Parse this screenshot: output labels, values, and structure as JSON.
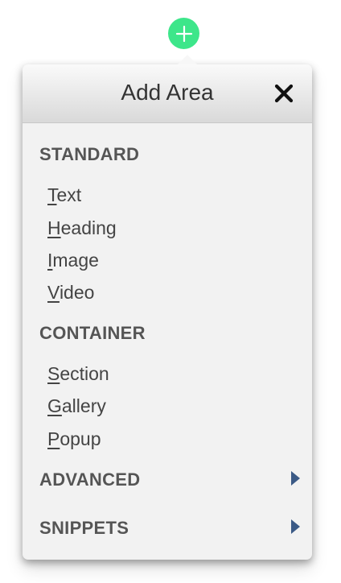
{
  "header": {
    "title": "Add Area",
    "close_icon": "close-icon"
  },
  "add_button": {
    "icon": "plus-icon",
    "color": "#3de68a"
  },
  "sections": {
    "standard": {
      "heading": "STANDARD",
      "items": [
        {
          "accel": "T",
          "rest": "ext"
        },
        {
          "accel": "H",
          "rest": "eading"
        },
        {
          "accel": "I",
          "rest": "mage"
        },
        {
          "accel": "V",
          "rest": "ideo"
        }
      ]
    },
    "container": {
      "heading": "CONTAINER",
      "items": [
        {
          "accel": "S",
          "rest": "ection"
        },
        {
          "accel": "G",
          "rest": "allery"
        },
        {
          "accel": "P",
          "rest": "opup"
        }
      ]
    },
    "advanced": {
      "heading": "ADVANCED",
      "icon": "chevron-right-icon"
    },
    "snippets": {
      "heading": "SNIPPETS",
      "icon": "chevron-right-icon"
    }
  },
  "colors": {
    "accent": "#3de68a",
    "arrow": "#3b5a86",
    "panel_bg": "#f2f2f2"
  }
}
